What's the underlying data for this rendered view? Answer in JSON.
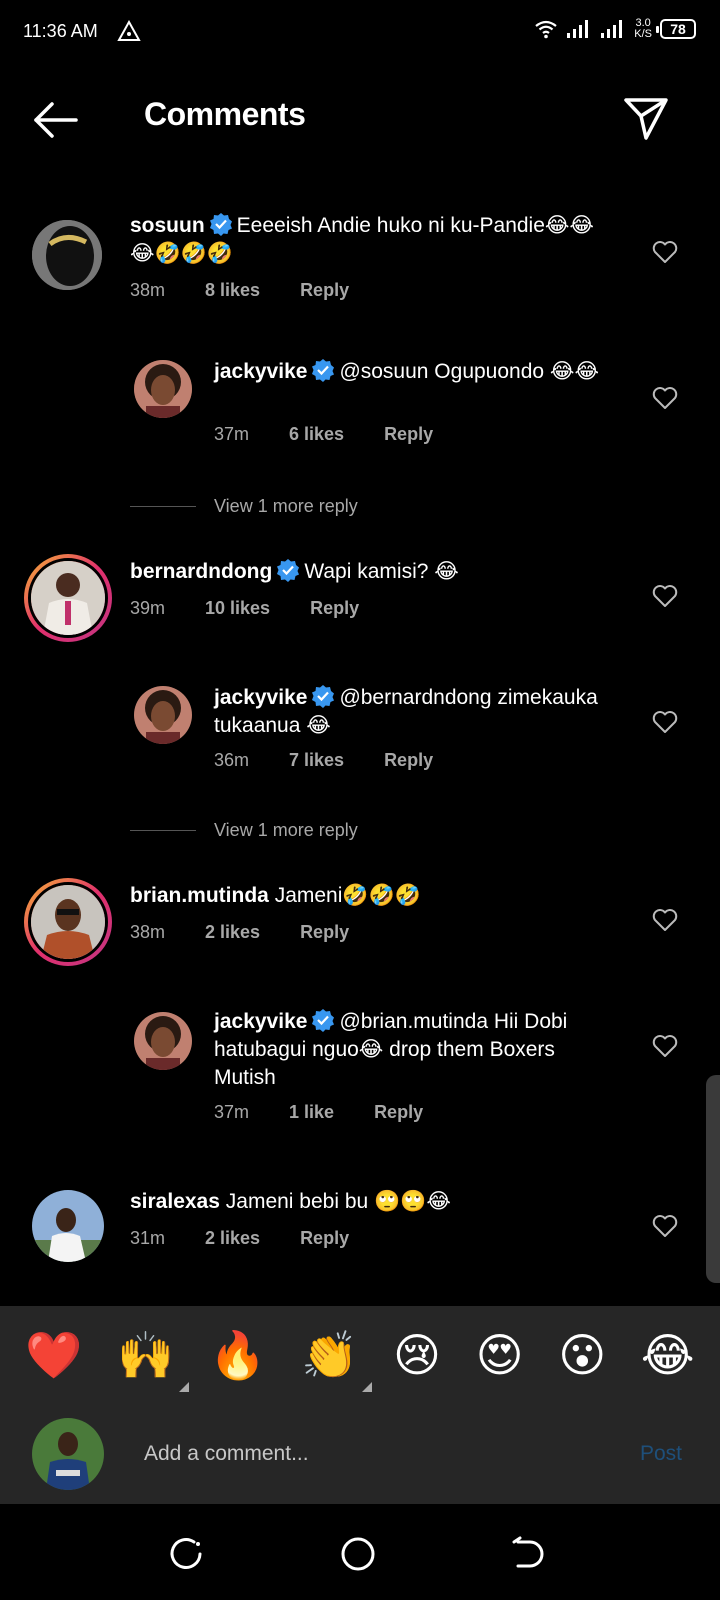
{
  "status": {
    "time": "11:36 AM",
    "net_speed_value": "3.0",
    "net_speed_unit": "K/S",
    "battery": "78"
  },
  "header": {
    "title": "Comments"
  },
  "comments": [
    {
      "username": "sosuun",
      "verified": true,
      "text": "Eeeeish Andie huko ni ku-Pandie😂😂😂🤣🤣🤣",
      "time": "38m",
      "likes": "8 likes",
      "reply": "Reply"
    },
    {
      "username": "jackyvike",
      "verified": true,
      "text": "@sosuun Ogupuondo 😂😂",
      "time": "37m",
      "likes": "6 likes",
      "reply": "Reply"
    },
    {
      "username": "bernardndong",
      "verified": true,
      "text": "Wapi kamisi? 😂",
      "time": "39m",
      "likes": "10 likes",
      "reply": "Reply"
    },
    {
      "username": "jackyvike",
      "verified": true,
      "text": "@bernardndong zimekauka tukaanua 😂",
      "time": "36m",
      "likes": "7 likes",
      "reply": "Reply"
    },
    {
      "username": "brian.mutinda",
      "verified": false,
      "text": "Jameni🤣🤣🤣",
      "time": "38m",
      "likes": "2 likes",
      "reply": "Reply"
    },
    {
      "username": "jackyvike",
      "verified": true,
      "text": "@brian.mutinda Hii Dobi hatubagui nguo😂 drop them Boxers Mutish",
      "time": "37m",
      "likes": "1 like",
      "reply": "Reply"
    },
    {
      "username": "siralexas",
      "verified": false,
      "text": "Jameni bebi bu 🙄🙄😂",
      "time": "31m",
      "likes": "2 likes",
      "reply": "Reply"
    }
  ],
  "view_more": [
    "View 1 more reply",
    "View 1 more reply"
  ],
  "emoji_bar": [
    "❤️",
    "🙌",
    "🔥",
    "👏",
    "😢",
    "😍",
    "😮",
    "😂"
  ],
  "composer": {
    "placeholder": "Add a comment...",
    "post_label": "Post"
  },
  "colors": {
    "background": "#000000",
    "panel": "#262626",
    "verified_blue": "#3897f0",
    "post_disabled": "#1e4f7a",
    "story_ring_start": "#f7b733",
    "story_ring_end": "#c13584"
  }
}
